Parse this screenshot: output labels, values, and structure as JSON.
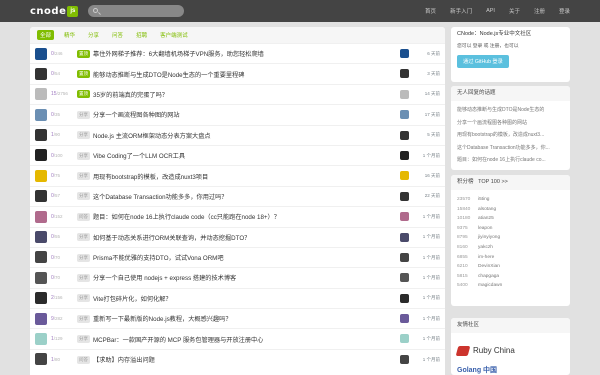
{
  "topbar": {
    "logo_text": "cnode",
    "logo_badge": "js",
    "search_placeholder": "",
    "nav": [
      "首页",
      "新手入门",
      "API",
      "关于",
      "注册",
      "登录"
    ]
  },
  "tabs": [
    "全部",
    "精华",
    "分享",
    "问答",
    "招聘",
    "客户端测试"
  ],
  "topics": [
    {
      "replies": "0",
      "visits": "246",
      "tag": "置顶",
      "tag_type": "top",
      "title": "靠住外网梯子推荐：6大翻墙机场梯子VPN服务，助您轻松爬墙",
      "time": "6 天前",
      "avatar_color": "#1a4f8e"
    },
    {
      "replies": "0",
      "visits": "54",
      "tag": "置顶",
      "tag_type": "top",
      "title": "能够动态推断与生成DTO是Node生态的一个重要里程碑",
      "time": "3 天前",
      "avatar_color": "#333333"
    },
    {
      "replies": "15",
      "visits": "2756",
      "tag": "置顶",
      "tag_type": "top",
      "title": "35岁的前端真的完蛋了吗？",
      "time": "14 天前",
      "avatar_color": "#bbbbbb"
    },
    {
      "replies": "0",
      "visits": "35",
      "tag": "分享",
      "tag_type": "normal",
      "title": "分享一个画流程图各种图的网站",
      "time": "17 天前",
      "avatar_color": "#6b8fb3"
    },
    {
      "replies": "1",
      "visits": "90",
      "tag": "分享",
      "tag_type": "normal",
      "title": "Node.js 主流ORM框架动态分表方案大盘点",
      "time": "5 天前",
      "avatar_color": "#333333"
    },
    {
      "replies": "0",
      "visits": "100",
      "tag": "分享",
      "tag_type": "normal",
      "title": "Vibe Coding了一个LLM OCR工具",
      "time": "1 个月前",
      "avatar_color": "#222222"
    },
    {
      "replies": "0",
      "visits": "75",
      "tag": "分享",
      "tag_type": "normal",
      "title": "用现有bootstrap的模板，改造成nuxt3项目",
      "time": "16 天前",
      "avatar_color": "#e5b800"
    },
    {
      "replies": "0",
      "visits": "57",
      "tag": "分享",
      "tag_type": "normal",
      "title": "这个Database Transaction功能多多，你用过吗？",
      "time": "22 天前",
      "avatar_color": "#333333"
    },
    {
      "replies": "0",
      "visits": "152",
      "tag": "问答",
      "tag_type": "normal",
      "title": "题目：如何在node 16上执行claude code（cc只能跑在node 18+）？",
      "time": "1 个月前",
      "avatar_color": "#b06a8c"
    },
    {
      "replies": "0",
      "visits": "55",
      "tag": "分享",
      "tag_type": "normal",
      "title": "如何基于动态关系进行ORM关联查询，并动态挖掘DTO？",
      "time": "1 个月前",
      "avatar_color": "#4a4a6a"
    },
    {
      "replies": "0",
      "visits": "70",
      "tag": "分享",
      "tag_type": "normal",
      "title": "Prisma不能优雅的支持DTO，试试Vona ORM吧",
      "time": "1 个月前",
      "avatar_color": "#444444"
    },
    {
      "replies": "0",
      "visits": "70",
      "tag": "分享",
      "tag_type": "normal",
      "title": "分享一个自己使用 nodejs + express 搭建的技术博客",
      "time": "1 个月前",
      "avatar_color": "#555555"
    },
    {
      "replies": "2",
      "visits": "156",
      "tag": "分享",
      "tag_type": "normal",
      "title": "Vite打包碎片化，如何化解？",
      "time": "1 个月前",
      "avatar_color": "#2b2b2b"
    },
    {
      "replies": "9",
      "visits": "282",
      "tag": "分享",
      "tag_type": "normal",
      "title": "重新写一下最新版的Node.js教程，大概感兴趣吗？",
      "time": "1 个月前",
      "avatar_color": "#6a5a9a"
    },
    {
      "replies": "1",
      "visits": "129",
      "tag": "分享",
      "tag_type": "normal",
      "title": "MCPBar：一款国产开源的 MCP 服务包管理器与开放注册中心",
      "time": "1 个月前",
      "avatar_color": "#9bd0c8"
    },
    {
      "replies": "1",
      "visits": "80",
      "tag": "问答",
      "tag_type": "normal",
      "title": "【求助】内存溢出问题",
      "time": "1 个月前",
      "avatar_color": "#444444"
    }
  ],
  "sidebar": {
    "intro": "CNode：Node.js专业中文社区",
    "login_hint": "您可以 登录 或 注册，也可以",
    "github_btn": "通过 GitHub 登录",
    "unanswered_title": "无人回复的话题",
    "unanswered": [
      "能够动态推断与生成DTO是Node生态的",
      "分享一个画流程图各种图的网站",
      "用现有bootstrap的模板，改造成nuxt3...",
      "这个Database Transaction功能多多，你...",
      "题目：如何在node 16上执行claude co..."
    ],
    "score_title": "积分榜",
    "score_link": "TOP 100 >>",
    "scores": [
      {
        "score": "23570",
        "user": "i5ting"
      },
      {
        "score": "15840",
        "user": "alsotang"
      },
      {
        "score": "10180",
        "user": "atian25"
      },
      {
        "score": "9375",
        "user": "leapon"
      },
      {
        "score": "8795",
        "user": "jiyinyiyong"
      },
      {
        "score": "8160",
        "user": "yakczh"
      },
      {
        "score": "6855",
        "user": "im-here"
      },
      {
        "score": "6210",
        "user": "DevinXian"
      },
      {
        "score": "5815",
        "user": "chapgaga"
      },
      {
        "score": "5400",
        "user": "magicdawn"
      }
    ],
    "friends_title": "友情社区",
    "ruby_china": "Ruby China",
    "golang": "Golang 中国"
  }
}
